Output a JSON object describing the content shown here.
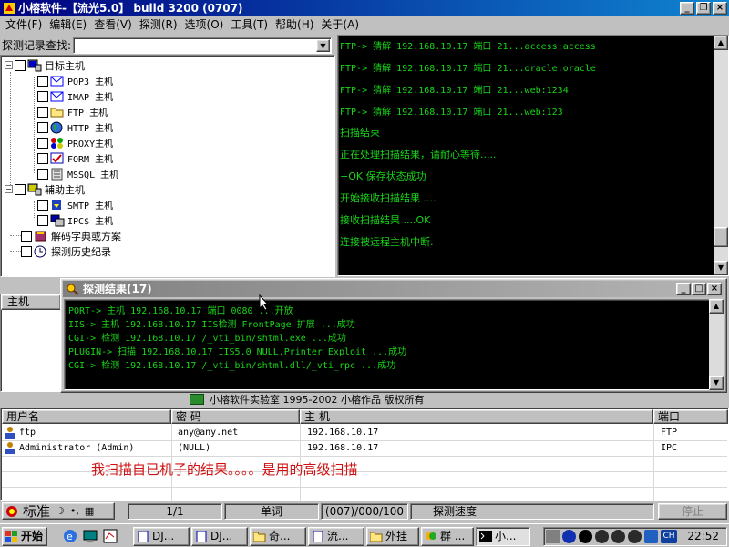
{
  "window": {
    "title": "小榕软件-【流光5.0】 build 3200 (0707)"
  },
  "menu": [
    "文件(F)",
    "编辑(E)",
    "查看(V)",
    "探测(R)",
    "选项(O)",
    "工具(T)",
    "帮助(H)",
    "关于(A)"
  ],
  "search": {
    "label": "探测记录查找:",
    "value": ""
  },
  "tree": {
    "target": "目标主机",
    "target_children": [
      "POP3 主机",
      "IMAP 主机",
      "FTP  主机",
      "HTTP 主机",
      "PROXY主机",
      "FORM 主机",
      "MSSQL  主机"
    ],
    "aux": "辅助主机",
    "aux_children": [
      "SMTP 主机",
      "IPC$ 主机"
    ],
    "dict": "解码字典或方案",
    "history": "探测历史纪录"
  },
  "console_lines": [
    "FTP-> 猜解 192.168.10.17 端口 21...access:access",
    "FTP-> 猜解 192.168.10.17 端口 21...oracle:oracle",
    "FTP-> 猜解 192.168.10.17 端口 21...web:1234",
    "FTP-> 猜解 192.168.10.17 端口 21...web:123",
    "扫描结束",
    "正在处理扫描结果，请耐心等待.....",
    "+OK 保存状态成功",
    "开始接收扫描结果 ....",
    "接收扫描结果 ....OK",
    "连接被远程主机中断."
  ],
  "host_panel": {
    "header": "主机"
  },
  "popup": {
    "title": "探测结果(17)",
    "lines": [
      "PORT-> 主机 192.168.10.17 端口 0080 ...开放",
      "IIS-> 主机 192.168.10.17 IIS检测 FrontPage 扩展 ...成功",
      "CGI-> 检测 192.168.10.17 /_vti_bin/shtml.exe ...成功",
      "PLUGIN-> 扫描 192.168.10.17 IIS5.0 NULL.Printer Exploit ...成功",
      "CGI-> 检测 192.168.10.17 /_vti_bin/shtml.dll/_vti_rpc ...成功"
    ]
  },
  "copyright": "小榕软件实验室 1995-2002 小榕作品 版权所有",
  "results": {
    "headers": [
      "用户名",
      "密  码",
      "主  机",
      "端口"
    ],
    "rows": [
      [
        "ftp",
        "any@any.net",
        "192.168.10.17",
        "FTP"
      ],
      [
        "Administrator (Admin)",
        "(NULL)",
        "192.168.10.17",
        "IPC"
      ]
    ]
  },
  "annotation": "我扫描自已机子的结果。。。。是用的高级扫描",
  "status": {
    "ime": "标准",
    "page": "1/1",
    "mode": "单词",
    "count": "(007)/000/100",
    "speed": "探测速度",
    "stop": "停止"
  },
  "taskbar": {
    "start": "开始",
    "buttons": [
      "DJ...",
      "DJ...",
      "奇...",
      "流...",
      "外挂",
      "群 ...",
      "小..."
    ],
    "clock": "22:52",
    "lang": "CH"
  },
  "colors": {
    "console_text": "#19d519",
    "title_active": "#000080",
    "annotation": "#d01010"
  }
}
